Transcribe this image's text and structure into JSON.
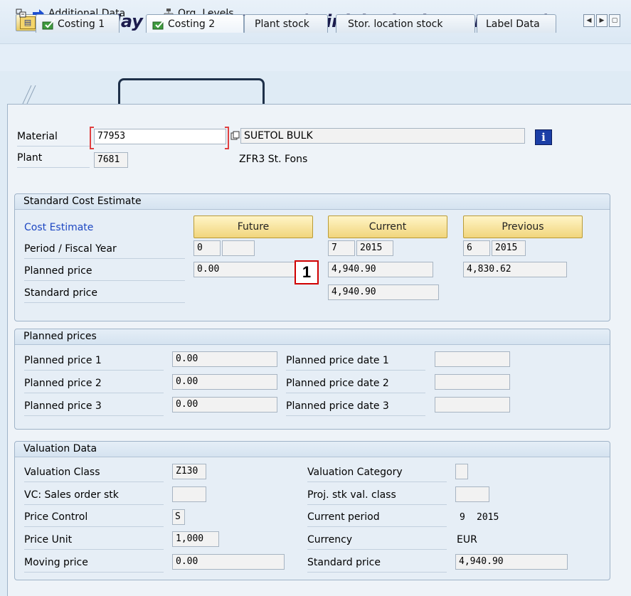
{
  "window": {
    "title": "Display Material 77953 (/Finished pdt & RM & SF)"
  },
  "toolbar": {
    "additional_data": "Additional Data",
    "org_levels": "Org. Levels"
  },
  "tabs": [
    {
      "label": "Costing 1"
    },
    {
      "label": "Costing 2"
    },
    {
      "label": "Plant stock"
    },
    {
      "label": "Stor. location stock"
    },
    {
      "label": "Label Data"
    }
  ],
  "header": {
    "material_label": "Material",
    "material_value": "77953",
    "material_desc": "SUETOL BULK",
    "plant_label": "Plant",
    "plant_value": "7681",
    "plant_desc": "ZFR3 St. Fons"
  },
  "standard_cost_estimate": {
    "title": "Standard Cost Estimate",
    "cost_estimate_label": "Cost Estimate",
    "future_btn": "Future",
    "current_btn": "Current",
    "previous_btn": "Previous",
    "period_label": "Period / Fiscal Year",
    "planned_price_label": "Planned price",
    "standard_price_label": "Standard price",
    "future": {
      "period": "0",
      "year": "",
      "planned_price": "0.00"
    },
    "current": {
      "period": "7",
      "year": "2015",
      "planned_price": "4,940.90",
      "standard_price": "4,940.90"
    },
    "previous": {
      "period": "6",
      "year": "2015",
      "planned_price": "4,830.62"
    }
  },
  "annotation": {
    "marker": "1"
  },
  "planned_prices": {
    "title": "Planned prices",
    "rows": [
      {
        "label": "Planned price 1",
        "value": "0.00",
        "date_label": "Planned price date 1",
        "date": ""
      },
      {
        "label": "Planned price 2",
        "value": "0.00",
        "date_label": "Planned price date 2",
        "date": ""
      },
      {
        "label": "Planned price 3",
        "value": "0.00",
        "date_label": "Planned price date 3",
        "date": ""
      }
    ]
  },
  "valuation": {
    "title": "Valuation Data",
    "valuation_class_label": "Valuation Class",
    "valuation_class": "Z130",
    "valuation_category_label": "Valuation Category",
    "valuation_category": "",
    "vc_sales_label": "VC: Sales order stk",
    "vc_sales": "",
    "proj_stk_label": "Proj. stk val. class",
    "proj_stk": "",
    "price_control_label": "Price Control",
    "price_control": "S",
    "current_period_label": "Current period",
    "current_period": "9",
    "current_period_year": "2015",
    "price_unit_label": "Price Unit",
    "price_unit": "1,000",
    "currency_label": "Currency",
    "currency": "EUR",
    "moving_price_label": "Moving price",
    "moving_price": "0.00",
    "standard_price_label": "Standard price",
    "standard_price": "4,940.90"
  }
}
